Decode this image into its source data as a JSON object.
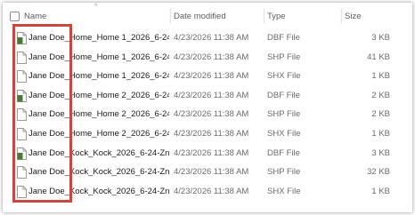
{
  "columns": {
    "name": "Name",
    "date_modified": "Date modified",
    "type": "Type",
    "size": "Size"
  },
  "files": [
    {
      "name": "Jane Doe_Home_Home 1_2026_6-24-...",
      "date": "4/23/2026 11:38 AM",
      "type": "DBF File",
      "size": "3 KB",
      "icon": "dbf-file-icon"
    },
    {
      "name": "Jane Doe_Home_Home 1_2026_6-24-...",
      "date": "4/23/2026 11:38 AM",
      "type": "SHP File",
      "size": "41 KB",
      "icon": "generic-file-icon"
    },
    {
      "name": "Jane Doe_Home_Home 1_2026_6-24-...",
      "date": "4/23/2026 11:38 AM",
      "type": "SHX File",
      "size": "1 KB",
      "icon": "generic-file-icon"
    },
    {
      "name": "Jane Doe_Home_Home 2_2026_6-24-...",
      "date": "4/23/2026 11:38 AM",
      "type": "DBF File",
      "size": "2 KB",
      "icon": "dbf-file-icon"
    },
    {
      "name": "Jane Doe_Home_Home 2_2026_6-24-...",
      "date": "4/23/2026 11:38 AM",
      "type": "SHP File",
      "size": "2 KB",
      "icon": "generic-file-icon"
    },
    {
      "name": "Jane Doe_Home_Home 2_2026_6-24-...",
      "date": "4/23/2026 11:38 AM",
      "type": "SHX File",
      "size": "1 KB",
      "icon": "generic-file-icon"
    },
    {
      "name": "Jane Doe_Kock_Kock_2026_6-24-Zn_...",
      "date": "4/23/2026 11:38 AM",
      "type": "DBF File",
      "size": "3 KB",
      "icon": "dbf-file-icon"
    },
    {
      "name": "Jane Doe_Kock_Kock_2026_6-24-Zn_...",
      "date": "4/23/2026 11:38 AM",
      "type": "SHP File",
      "size": "32 KB",
      "icon": "generic-file-icon"
    },
    {
      "name": "Jane Doe_Kock_Kock_2026_6-24-Zn_...",
      "date": "4/23/2026 11:38 AM",
      "type": "SHX File",
      "size": "1 KB",
      "icon": "generic-file-icon"
    }
  ],
  "colors": {
    "highlight": "#c9473f",
    "dbf_icon": "#4a7a3a"
  }
}
